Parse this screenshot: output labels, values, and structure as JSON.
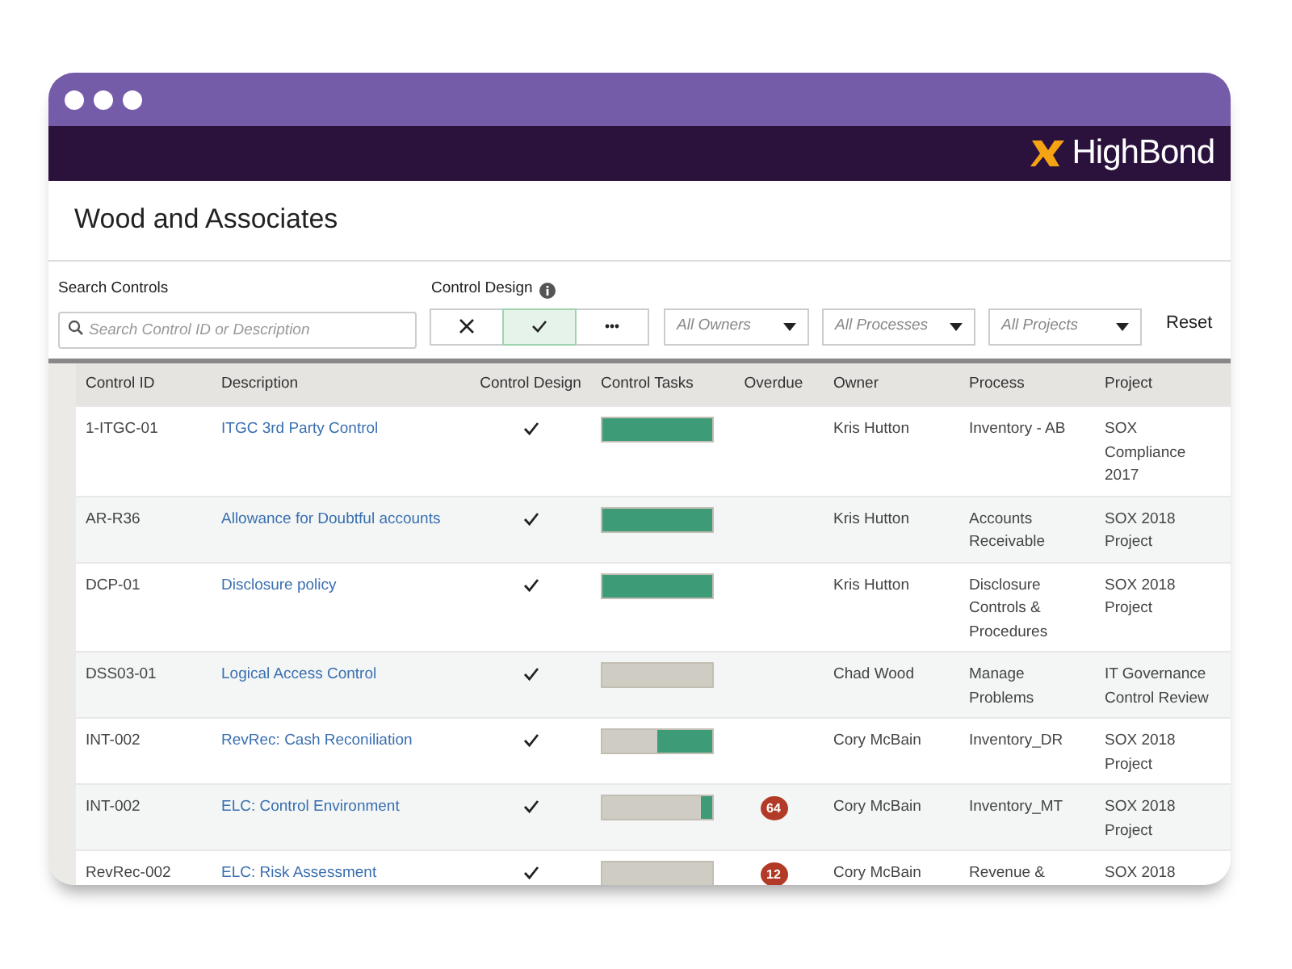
{
  "brand": {
    "name": "HighBond"
  },
  "page": {
    "title": "Wood and Associates"
  },
  "filters": {
    "search_label": "Search Controls",
    "search_placeholder": "Search Control ID or Description",
    "design_label": "Control Design",
    "design_options": [
      {
        "kind": "fail",
        "selected": false
      },
      {
        "kind": "pass",
        "selected": true
      },
      {
        "kind": "more",
        "selected": false
      }
    ],
    "dropdowns": [
      "All Owners",
      "All Processes",
      "All Projects"
    ],
    "reset": "Reset"
  },
  "table": {
    "columns": [
      "Control ID",
      "Description",
      "Control Design",
      "Control Tasks",
      "Overdue",
      "Owner",
      "Process",
      "Project"
    ],
    "rows": [
      {
        "id": "1-ITGC-01",
        "description": "ITGC 3rd Party Control",
        "design": true,
        "level": 1.0,
        "overdue": "",
        "owner": "Kris Hutton",
        "process": "Inventory - AB",
        "project": "SOX Compliance 2017"
      },
      {
        "id": "AR-R36",
        "description": "Allowance for Doubtful accounts",
        "design": true,
        "level": 1.0,
        "overdue": "",
        "owner": "Kris Hutton",
        "process": "Accounts Receivable",
        "project": "SOX 2018 Project"
      },
      {
        "id": "DCP-01",
        "description": "Disclosure policy",
        "design": true,
        "level": 1.0,
        "overdue": "",
        "owner": "Kris Hutton",
        "process": "Disclosure Controls & Procedures",
        "project": "SOX 2018 Project"
      },
      {
        "id": "DSS03-01",
        "description": "Logical Access Control",
        "design": true,
        "level": 0,
        "overdue": "",
        "owner": "Chad Wood",
        "process": "Manage Problems",
        "project": "IT Governance Control Review"
      },
      {
        "id": "INT-002",
        "description": "RevRec: Cash Reconiliation",
        "design": true,
        "level": 0.5,
        "overdue": "",
        "owner": "Cory McBain",
        "process": "Inventory_DR",
        "project": "SOX 2018 Project"
      },
      {
        "id": "INT-002",
        "description": "ELC: Control Environment",
        "design": true,
        "level": 0.1,
        "overdue": "64",
        "owner": "Cory McBain",
        "process": "Inventory_MT",
        "project": "SOX 2018 Project"
      },
      {
        "id": "RevRec-002",
        "description": "ELC: Risk Assessment",
        "design": true,
        "level": 0,
        "overdue": "12",
        "owner": "Cory McBain",
        "process": "Revenue &",
        "project": "SOX 2018"
      }
    ]
  }
}
